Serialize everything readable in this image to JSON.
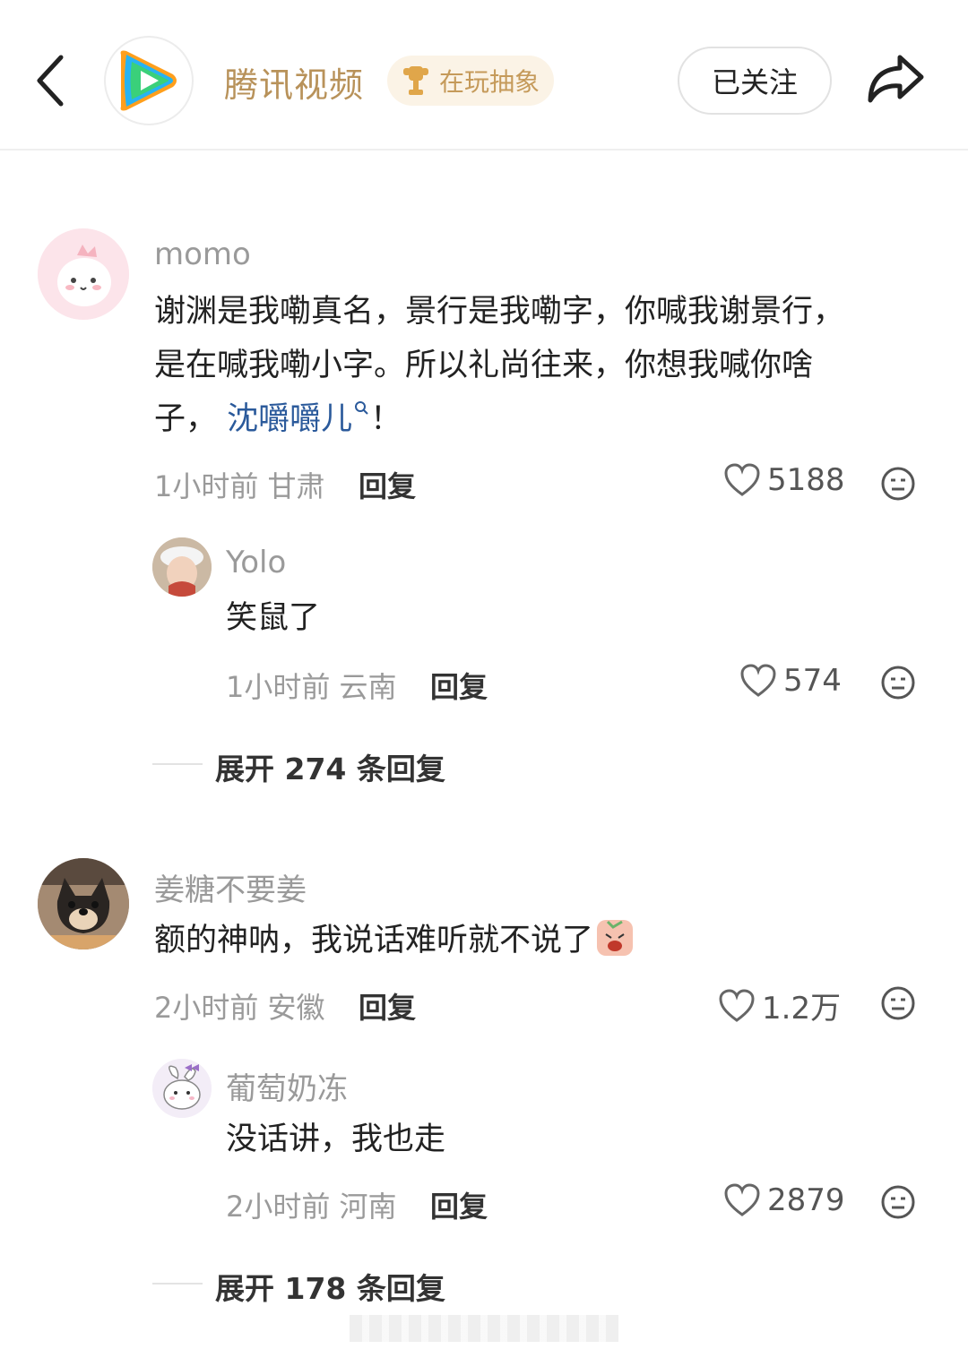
{
  "header": {
    "app_name": "腾讯视频",
    "tag": "在玩抽象",
    "follow_label": "已关注"
  },
  "comments": [
    {
      "username": "momo",
      "lines": [
        "谢渊是我嘞真名，景行是我嘞字，你喊我谢景行，",
        "是在喊我嘞小字。所以礼尚往来，你想我喊你啥",
        "子，"
      ],
      "mention": "沈嚼嚼儿",
      "tail": "！",
      "time_loc": "1小时前 甘肃",
      "reply_label": "回复",
      "likes": "5188",
      "replies": [
        {
          "username": "Yolo",
          "text": "笑鼠了",
          "time_loc": "1小时前 云南",
          "reply_label": "回复",
          "likes": "574"
        }
      ],
      "expand_label": "展开 274 条回复"
    },
    {
      "username": "姜糖不要姜",
      "text": "额的神呐，我说话难听就不说了",
      "time_loc": "2小时前 安徽",
      "reply_label": "回复",
      "likes": "1.2万",
      "replies": [
        {
          "username": "葡萄奶冻",
          "text": "没话讲，我也走",
          "time_loc": "2小时前 河南",
          "reply_label": "回复",
          "likes": "2879"
        }
      ],
      "expand_label": "展开 178 条回复"
    }
  ],
  "colors": {
    "brand_gold": "#b8925a",
    "mention_blue": "#2b5a9b",
    "muted_text": "#9a9a9a"
  }
}
